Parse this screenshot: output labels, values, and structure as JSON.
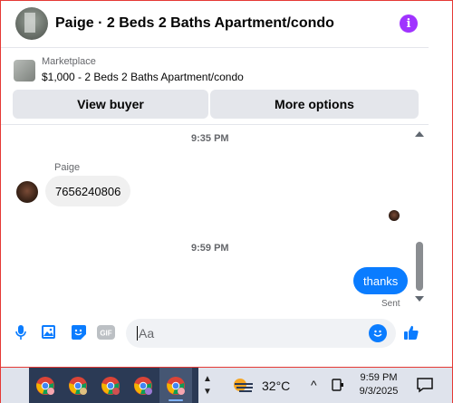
{
  "header": {
    "title": "Paige · 2 Beds 2 Baths Apartment/condo",
    "info_icon": "info-icon"
  },
  "marketplace": {
    "source": "Marketplace",
    "listing": "$1,000 - 2 Beds 2 Baths Apartment/condo",
    "view_buyer": "View buyer",
    "more_options": "More options"
  },
  "chat": {
    "time_1": "9:35 PM",
    "sender": "Paige",
    "incoming_message": "7656240806",
    "time_2": "9:59 PM",
    "outgoing_message": "thanks",
    "status": "Sent"
  },
  "composer": {
    "placeholder": "Aa",
    "icons": [
      "microphone-icon",
      "photo-icon",
      "sticker-icon",
      "gif-icon",
      "emoji-icon",
      "thumbs-up-icon"
    ],
    "gif_label": "GIF"
  },
  "taskbar": {
    "apps": [
      "chrome-icon",
      "chrome-icon",
      "chrome-icon",
      "chrome-icon",
      "chrome-icon"
    ],
    "temperature": "32°C",
    "time": "9:59 PM",
    "date": "9/3/2025"
  },
  "colors": {
    "accent": "#0a7cff",
    "info": "#a033ff",
    "button_bg": "#e4e6eb"
  }
}
